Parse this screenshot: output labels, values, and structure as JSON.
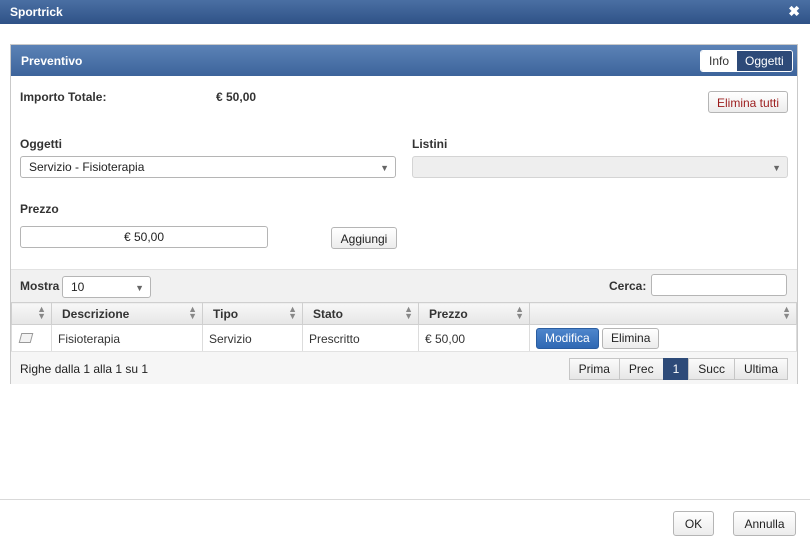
{
  "window": {
    "title": "Sportrick",
    "close_glyph": "✖"
  },
  "panel": {
    "title": "Preventivo",
    "tabs": {
      "info": "Info",
      "oggetti": "Oggetti"
    }
  },
  "summary": {
    "label": "Importo Totale:",
    "value": "€ 50,00",
    "delete_all": "Elimina tutti"
  },
  "form": {
    "oggetti_label": "Oggetti",
    "oggetti_value": "Servizio - Fisioterapia",
    "listini_label": "Listini",
    "listini_value": "",
    "prezzo_label": "Prezzo",
    "prezzo_value": "€ 50,00",
    "add_label": "Aggiungi"
  },
  "table_toolbar": {
    "show_label": "Mostra",
    "show_value": "10",
    "search_label": "Cerca:",
    "search_value": ""
  },
  "table": {
    "columns": [
      "",
      "Descrizione",
      "Tipo",
      "Stato",
      "Prezzo",
      ""
    ],
    "rows": [
      {
        "descrizione": "Fisioterapia",
        "tipo": "Servizio",
        "stato": "Prescritto",
        "prezzo": "€ 50,00",
        "edit": "Modifica",
        "delete": "Elimina"
      }
    ]
  },
  "pagination": {
    "info": "Righe dalla 1 alla 1 su 1",
    "first": "Prima",
    "prev": "Prec",
    "current": "1",
    "next": "Succ",
    "last": "Ultima"
  },
  "dialog_buttons": {
    "ok": "OK",
    "cancel": "Annulla"
  },
  "colors": {
    "header": "#3d649b",
    "primary_button": "#2f68b3",
    "danger_text": "#9b1c1c"
  },
  "icons": {
    "row_icon": "note-icon",
    "sort": "sort-icon",
    "dropdown": "chevron-down-icon",
    "close": "close-icon"
  }
}
